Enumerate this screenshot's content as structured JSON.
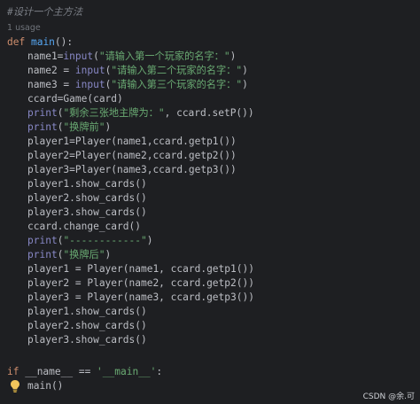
{
  "code": {
    "comment": "#设计一个主方法",
    "usage_hint": "1 usage",
    "def_kw": "def",
    "def_name": "main",
    "def_rest": "():",
    "l1_a": "name1=",
    "l1_b": "input",
    "l1_c": "(",
    "l1_str": "\"请输入第一个玩家的名字：\"",
    "l1_d": ")",
    "l2_a": "name2 = ",
    "l2_b": "input",
    "l2_c": "(",
    "l2_str": "\"请输入第二个玩家的名字：\"",
    "l2_d": ")",
    "l3_a": "name3 = ",
    "l3_b": "input",
    "l3_c": "(",
    "l3_str": "\"请输入第三个玩家的名字：\"",
    "l3_d": ")",
    "l4": "ccard=Game(card)",
    "l5_a": "print",
    "l5_b": "(",
    "l5_str": "\"剩余三张地主牌为：\"",
    "l5_c": ", ccard.setP())",
    "l6_a": "print",
    "l6_b": "(",
    "l6_str": "\"换牌前\"",
    "l6_c": ")",
    "l7": "player1=Player(name1,ccard.getp1())",
    "l8": "player2=Player(name2,ccard.getp2())",
    "l9": "player3=Player(name3,ccard.getp3())",
    "l10": "player1.show_cards()",
    "l11": "player2.show_cards()",
    "l12": "player3.show_cards()",
    "l13": "ccard.change_card()",
    "l14_a": "print",
    "l14_b": "(",
    "l14_str": "\"------------\"",
    "l14_c": ")",
    "l15_a": "print",
    "l15_b": "(",
    "l15_str": "\"换牌后\"",
    "l15_c": ")",
    "l16": "player1 = Player(name1, ccard.getp1())",
    "l17": "player2 = Player(name2, ccard.getp2())",
    "l18": "player3 = Player(name3, ccard.getp3())",
    "l19": "player1.show_cards()",
    "l20": "player2.show_cards()",
    "l21": "player3.show_cards()",
    "if_kw": "if",
    "if_rest": " __name__ == ",
    "if_str": "'__main__'",
    "if_colon": ":",
    "main_call": "main()"
  },
  "icons": {
    "bulb": "lightbulb-icon"
  },
  "watermark": "CSDN @余.可"
}
